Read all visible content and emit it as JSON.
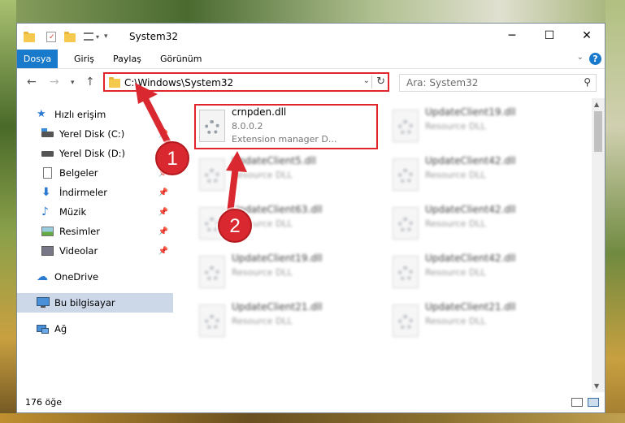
{
  "window": {
    "title": "System32",
    "controls": {
      "minimize": "─",
      "maximize": "☐",
      "close": "✕"
    }
  },
  "ribbon": {
    "tabs": [
      "Dosya",
      "Giriş",
      "Paylaş",
      "Görünüm"
    ],
    "help": "?"
  },
  "navigation": {
    "address": "C:\\Windows\\System32",
    "search_placeholder": "Ara: System32"
  },
  "sidebar": {
    "items": [
      {
        "label": "Hızlı erişim",
        "icon": "star-icon"
      },
      {
        "label": "Yerel Disk (C:)",
        "icon": "drive-icon"
      },
      {
        "label": "Yerel Disk (D:)",
        "icon": "drive-icon"
      },
      {
        "label": "Belgeler",
        "icon": "documents-icon"
      },
      {
        "label": "İndirmeler",
        "icon": "download-icon"
      },
      {
        "label": "Müzik",
        "icon": "music-icon"
      },
      {
        "label": "Resimler",
        "icon": "pictures-icon"
      },
      {
        "label": "Videolar",
        "icon": "videos-icon"
      },
      {
        "label": "OneDrive",
        "icon": "cloud-icon"
      },
      {
        "label": "Bu bilgisayar",
        "icon": "computer-icon"
      },
      {
        "label": "Ağ",
        "icon": "network-icon"
      }
    ]
  },
  "files": {
    "main": {
      "name": "crnpden.dll",
      "version": "8.0.0.2",
      "description": "Extension manager D..."
    },
    "others": [
      {
        "name": "UpdateClient19.dll",
        "type": "Resource DLL"
      },
      {
        "name": "UpdateClient5.dll",
        "type": "Resource DLL"
      },
      {
        "name": "UpdateClient42.dll",
        "type": "Resource DLL"
      },
      {
        "name": "UpdateClient63.dll",
        "type": "Resource DLL"
      },
      {
        "name": "UpdateClient42.dll",
        "type": "Resource DLL"
      },
      {
        "name": "UpdateClient19.dll",
        "type": "Resource DLL"
      },
      {
        "name": "UpdateClient42.dll",
        "type": "Resource DLL"
      },
      {
        "name": "UpdateClient21.dll",
        "type": "Resource DLL"
      },
      {
        "name": "UpdateClient21.dll",
        "type": "Resource DLL"
      }
    ]
  },
  "status": {
    "count": "176 öğe"
  },
  "annotations": {
    "marker1": "1",
    "marker2": "2"
  },
  "colors": {
    "accent": "#1979ca",
    "annotation": "#d9282f",
    "selection": "#ccd8e8"
  }
}
